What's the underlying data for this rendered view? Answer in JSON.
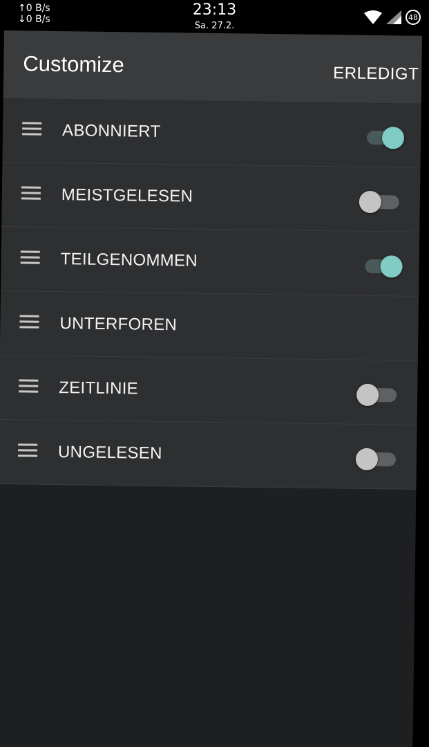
{
  "statusbar": {
    "upload": "↑0 B/s",
    "download": "↓0 B/s",
    "time": "23:13",
    "date": "Sa. 27.2.",
    "battery": "48",
    "icons": [
      "wifi-icon",
      "signal-icon",
      "battery-icon"
    ]
  },
  "appbar": {
    "title": "Customize",
    "done_label": "ERLEDIGT"
  },
  "colors": {
    "accent": "#80cbc4",
    "appbar": "#3a3b3d",
    "list_background": "#2e2f31",
    "page_background": "#1e1f21"
  },
  "items": [
    {
      "label": "ABONNIERT",
      "toggle": "on"
    },
    {
      "label": "MEISTGELESEN",
      "toggle": "off"
    },
    {
      "label": "TEILGENOMMEN",
      "toggle": "on"
    },
    {
      "label": "UNTERFOREN",
      "toggle": "none"
    },
    {
      "label": "ZEITLINIE",
      "toggle": "off"
    },
    {
      "label": "UNGELESEN",
      "toggle": "off"
    }
  ]
}
